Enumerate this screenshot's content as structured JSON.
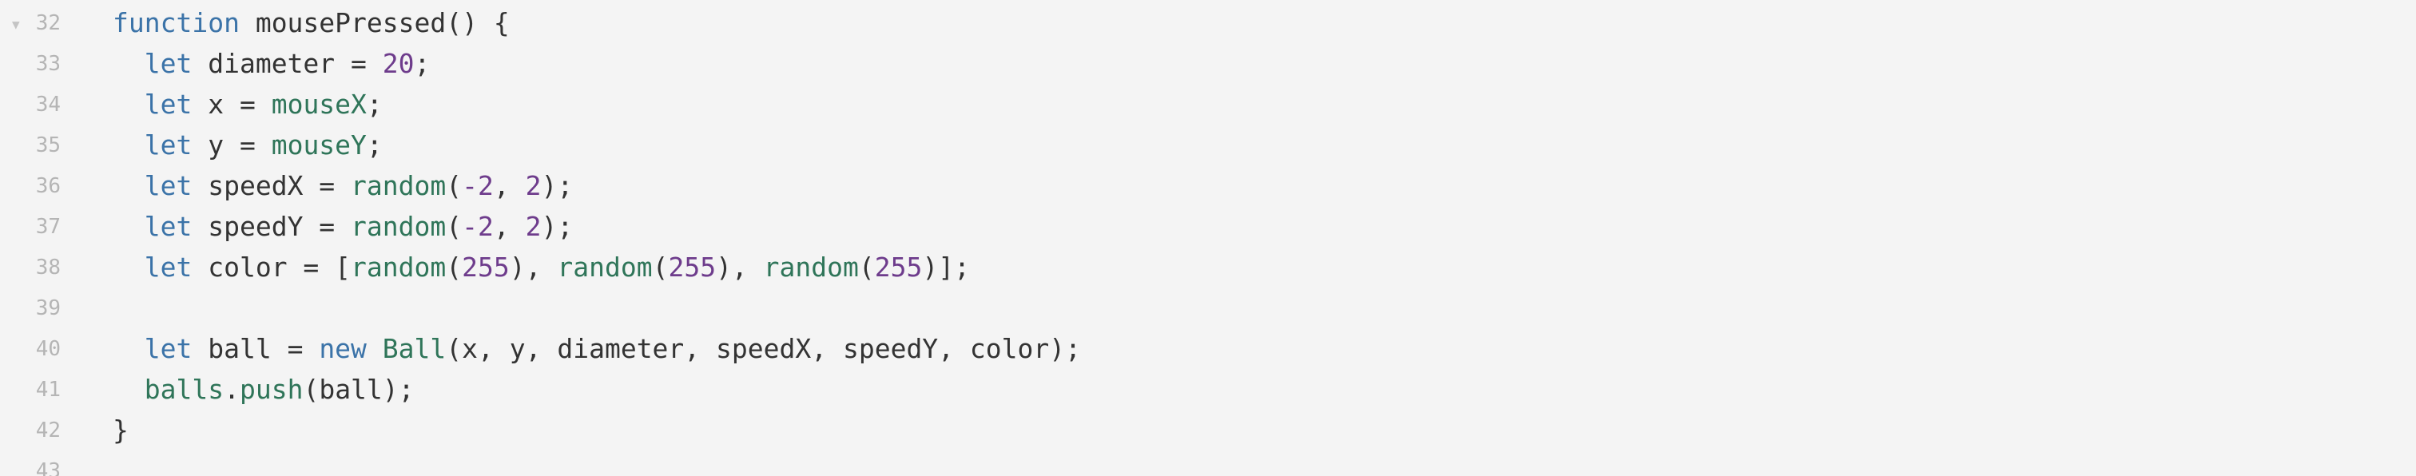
{
  "editor": {
    "fold_marker": "▼",
    "lines": [
      {
        "number": "32",
        "foldable": true,
        "tokens": [
          {
            "t": "function",
            "k": "kw"
          },
          {
            "t": " mousePressed() {",
            "k": "id"
          }
        ]
      },
      {
        "number": "33",
        "foldable": false,
        "tokens": [
          {
            "t": "  ",
            "k": "pn"
          },
          {
            "t": "let",
            "k": "kw"
          },
          {
            "t": " diameter = ",
            "k": "id"
          },
          {
            "t": "20",
            "k": "num"
          },
          {
            "t": ";",
            "k": "pn"
          }
        ]
      },
      {
        "number": "34",
        "foldable": false,
        "tokens": [
          {
            "t": "  ",
            "k": "pn"
          },
          {
            "t": "let",
            "k": "kw"
          },
          {
            "t": " x = ",
            "k": "id"
          },
          {
            "t": "mouseX",
            "k": "fn"
          },
          {
            "t": ";",
            "k": "pn"
          }
        ]
      },
      {
        "number": "35",
        "foldable": false,
        "tokens": [
          {
            "t": "  ",
            "k": "pn"
          },
          {
            "t": "let",
            "k": "kw"
          },
          {
            "t": " y = ",
            "k": "id"
          },
          {
            "t": "mouseY",
            "k": "fn"
          },
          {
            "t": ";",
            "k": "pn"
          }
        ]
      },
      {
        "number": "36",
        "foldable": false,
        "tokens": [
          {
            "t": "  ",
            "k": "pn"
          },
          {
            "t": "let",
            "k": "kw"
          },
          {
            "t": " speedX = ",
            "k": "id"
          },
          {
            "t": "random",
            "k": "fn"
          },
          {
            "t": "(",
            "k": "pn"
          },
          {
            "t": "-2",
            "k": "num"
          },
          {
            "t": ", ",
            "k": "pn"
          },
          {
            "t": "2",
            "k": "num"
          },
          {
            "t": ");",
            "k": "pn"
          }
        ]
      },
      {
        "number": "37",
        "foldable": false,
        "tokens": [
          {
            "t": "  ",
            "k": "pn"
          },
          {
            "t": "let",
            "k": "kw"
          },
          {
            "t": " speedY = ",
            "k": "id"
          },
          {
            "t": "random",
            "k": "fn"
          },
          {
            "t": "(",
            "k": "pn"
          },
          {
            "t": "-2",
            "k": "num"
          },
          {
            "t": ", ",
            "k": "pn"
          },
          {
            "t": "2",
            "k": "num"
          },
          {
            "t": ");",
            "k": "pn"
          }
        ]
      },
      {
        "number": "38",
        "foldable": false,
        "tokens": [
          {
            "t": "  ",
            "k": "pn"
          },
          {
            "t": "let",
            "k": "kw"
          },
          {
            "t": " color = [",
            "k": "id"
          },
          {
            "t": "random",
            "k": "fn"
          },
          {
            "t": "(",
            "k": "pn"
          },
          {
            "t": "255",
            "k": "num"
          },
          {
            "t": "), ",
            "k": "pn"
          },
          {
            "t": "random",
            "k": "fn"
          },
          {
            "t": "(",
            "k": "pn"
          },
          {
            "t": "255",
            "k": "num"
          },
          {
            "t": "), ",
            "k": "pn"
          },
          {
            "t": "random",
            "k": "fn"
          },
          {
            "t": "(",
            "k": "pn"
          },
          {
            "t": "255",
            "k": "num"
          },
          {
            "t": ")];",
            "k": "pn"
          }
        ]
      },
      {
        "number": "39",
        "foldable": false,
        "tokens": []
      },
      {
        "number": "40",
        "foldable": false,
        "tokens": [
          {
            "t": "  ",
            "k": "pn"
          },
          {
            "t": "let",
            "k": "kw"
          },
          {
            "t": " ball = ",
            "k": "id"
          },
          {
            "t": "new",
            "k": "kw"
          },
          {
            "t": " ",
            "k": "pn"
          },
          {
            "t": "Ball",
            "k": "fn"
          },
          {
            "t": "(x, y, diameter, speedX, speedY, color);",
            "k": "id"
          }
        ]
      },
      {
        "number": "41",
        "foldable": false,
        "tokens": [
          {
            "t": "  ",
            "k": "pn"
          },
          {
            "t": "balls",
            "k": "fn"
          },
          {
            "t": ".",
            "k": "pn"
          },
          {
            "t": "push",
            "k": "fn"
          },
          {
            "t": "(ball);",
            "k": "id"
          }
        ]
      },
      {
        "number": "42",
        "foldable": false,
        "tokens": [
          {
            "t": "}",
            "k": "pn"
          }
        ]
      },
      {
        "number": "43",
        "foldable": false,
        "tokens": []
      }
    ]
  },
  "colors": {
    "background": "#f4f4f4",
    "keyword": "#3b73a8",
    "function": "#2f7559",
    "number": "#6e3c8c",
    "text": "#333333",
    "gutter": "#b5b5b5"
  }
}
